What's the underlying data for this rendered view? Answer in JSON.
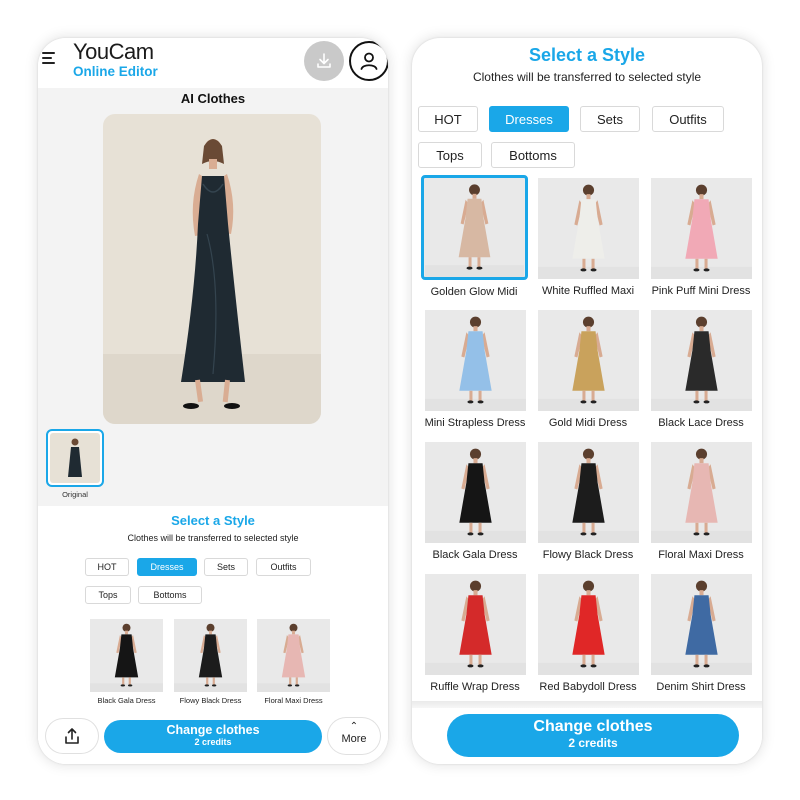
{
  "header": {
    "logo_main": "YouCam",
    "logo_sub": "Online Editor"
  },
  "page": {
    "title": "AI Clothes",
    "original_label": "Original"
  },
  "style_panel": {
    "title": "Select a Style",
    "subtitle": "Clothes will be transferred to selected style",
    "tabs": [
      "HOT",
      "Dresses",
      "Sets",
      "Outfits",
      "Tops",
      "Bottoms"
    ],
    "active_tab": "Dresses"
  },
  "left_cards": [
    {
      "name": "Black Gala Dress",
      "dress_color": "#151515"
    },
    {
      "name": "Flowy Black Dress",
      "dress_color": "#1c1c1c"
    },
    {
      "name": "Floral Maxi Dress",
      "dress_color": "#e7b7b3"
    }
  ],
  "right_cards": [
    {
      "name": "Golden Glow Midi",
      "dress_color": "#d7b8a3",
      "selected": true
    },
    {
      "name": "White Ruffled Maxi",
      "dress_color": "#eeeeea",
      "selected": false
    },
    {
      "name": "Pink Puff Mini Dress",
      "dress_color": "#f1a9b6",
      "selected": false
    },
    {
      "name": "Mini Strapless Dress",
      "dress_color": "#94c0e8",
      "selected": false
    },
    {
      "name": "Gold Midi Dress",
      "dress_color": "#c9a25c",
      "selected": false
    },
    {
      "name": "Black Lace Dress",
      "dress_color": "#2a2a2a",
      "selected": false
    },
    {
      "name": "Black Gala Dress",
      "dress_color": "#151515",
      "selected": false
    },
    {
      "name": "Flowy Black Dress",
      "dress_color": "#1c1c1c",
      "selected": false
    },
    {
      "name": "Floral Maxi Dress",
      "dress_color": "#e7b7b3",
      "selected": false
    },
    {
      "name": "Ruffle Wrap Dress",
      "dress_color": "#d42a2a",
      "selected": false
    },
    {
      "name": "Red Babydoll Dress",
      "dress_color": "#e02727",
      "selected": false
    },
    {
      "name": "Denim Shirt Dress",
      "dress_color": "#3f6aa3",
      "selected": false
    }
  ],
  "bottom_bar": {
    "change_label": "Change clothes",
    "credits_label": "2 credits",
    "more_label": "More"
  },
  "colors": {
    "accent": "#1aa7e8",
    "photo_bg": "#e8e2d8",
    "model_dress": "#1f2a32"
  },
  "icons": {
    "menu": "hamburger-icon",
    "download": "download-icon",
    "profile": "user-icon",
    "share": "share-icon",
    "more": "chevron-up-icon"
  }
}
